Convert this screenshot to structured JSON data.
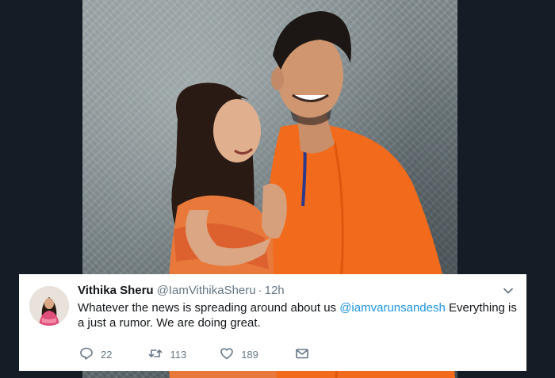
{
  "tweet": {
    "display_name": "Vithika Sheru",
    "handle": "@IamVithikaSheru",
    "separator": "·",
    "time": "12h",
    "text_before": "Whatever the news is spreading around about us ",
    "mention": "@iamvarunsandesh",
    "text_after": " Everything is a just a rumor. We are doing great.",
    "reply_count": "22",
    "retweet_count": "113",
    "like_count": "189"
  },
  "icons": {
    "reply": "reply-icon",
    "retweet": "retweet-icon",
    "like": "heart-icon",
    "message": "envelope-icon",
    "more": "chevron-down-icon"
  },
  "colors": {
    "background": "#141d26",
    "card": "#ffffff",
    "text": "#14171a",
    "secondary": "#657786",
    "link": "#1b95e0",
    "kurta": "#f26a1b"
  }
}
